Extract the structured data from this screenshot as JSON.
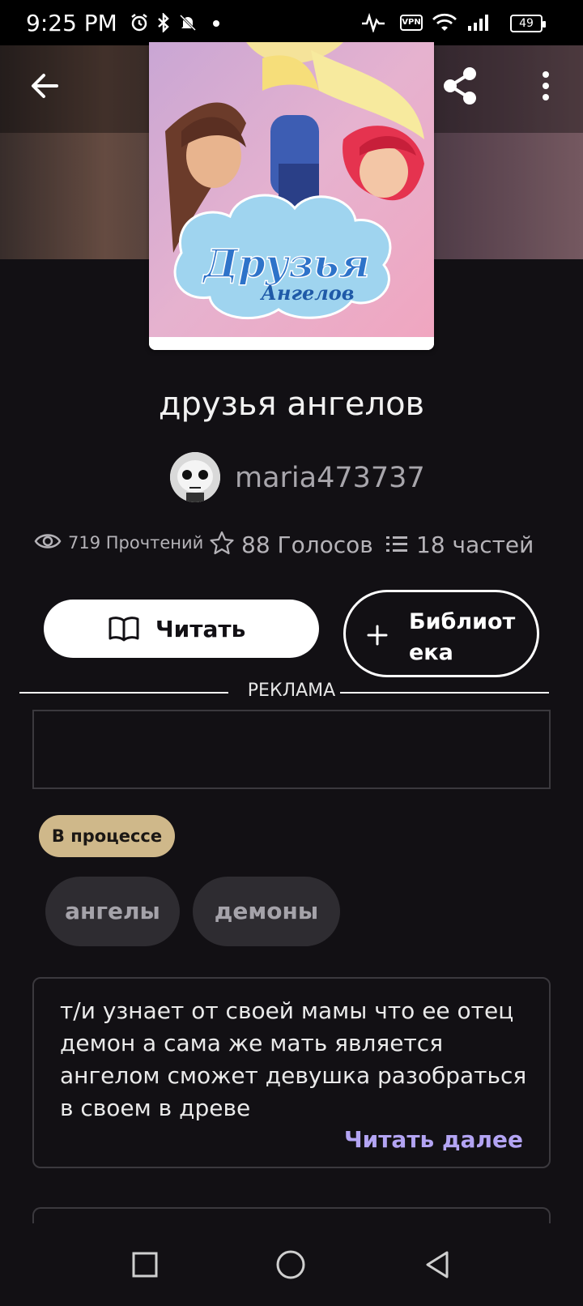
{
  "status_bar": {
    "time": "9:25 PM",
    "battery": "49",
    "vpn": "VPN"
  },
  "story": {
    "title": "друзья ангелов",
    "author": "maria473737",
    "cover_text": {
      "line1": "Друзья",
      "line2": "Ангелов"
    }
  },
  "stats": {
    "reads": "719 Прочтений",
    "votes": "88 Голосов",
    "parts": "18 частей"
  },
  "buttons": {
    "read": "Читать",
    "library": "Библиот ека"
  },
  "ad": {
    "label": "РЕКЛАМА"
  },
  "status_badge": "В процессе",
  "tags": [
    "ангелы",
    "демоны"
  ],
  "description": {
    "text": "т/и узнает от своей мамы что ее отец демон а сама же мать является ангелом сможет девушка разобраться в своем в древе",
    "read_more": "Читать далее"
  },
  "colors": {
    "background": "#121014",
    "badge": "#cfb88a",
    "read_more": "#b3a4f3",
    "tag_bg": "#2e2c31"
  }
}
